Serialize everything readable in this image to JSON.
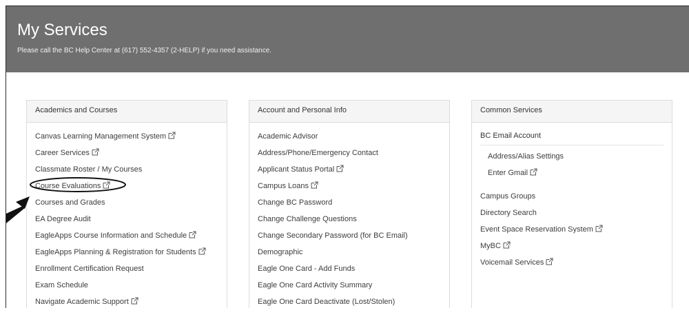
{
  "header": {
    "title": "My Services",
    "subtitle": "Please call the BC Help Center at (617) 552-4357 (2-HELP) if you need assistance."
  },
  "panels": [
    {
      "title": "Academics and Courses",
      "items": [
        {
          "label": "Canvas Learning Management System",
          "external": true
        },
        {
          "label": "Career Services",
          "external": true
        },
        {
          "label": "Classmate Roster / My Courses",
          "external": false
        },
        {
          "label": "Course Evaluations",
          "external": true
        },
        {
          "label": "Courses and Grades",
          "external": false
        },
        {
          "label": "EA Degree Audit",
          "external": false
        },
        {
          "label": "EagleApps Course Information and Schedule",
          "external": true
        },
        {
          "label": "EagleApps Planning & Registration for Students",
          "external": true
        },
        {
          "label": "Enrollment Certification Request",
          "external": false
        },
        {
          "label": "Exam Schedule",
          "external": false
        },
        {
          "label": "Navigate Academic Support",
          "external": true
        }
      ]
    },
    {
      "title": "Account and Personal Info",
      "items": [
        {
          "label": "Academic Advisor",
          "external": false
        },
        {
          "label": "Address/Phone/Emergency Contact",
          "external": false
        },
        {
          "label": "Applicant Status Portal",
          "external": true
        },
        {
          "label": "Campus Loans",
          "external": true
        },
        {
          "label": "Change BC Password",
          "external": false
        },
        {
          "label": "Change Challenge Questions",
          "external": false
        },
        {
          "label": "Change Secondary Password (for BC Email)",
          "external": false
        },
        {
          "label": "Demographic",
          "external": false
        },
        {
          "label": "Eagle One Card - Add Funds",
          "external": false
        },
        {
          "label": "Eagle One Card Activity Summary",
          "external": false
        },
        {
          "label": "Eagle One Card Deactivate (Lost/Stolen)",
          "external": false
        }
      ]
    },
    {
      "title": "Common Services",
      "email_heading": "BC Email Account",
      "email_items": [
        {
          "label": "Address/Alias Settings",
          "external": false
        },
        {
          "label": "Enter Gmail",
          "external": true
        }
      ],
      "items": [
        {
          "label": "Campus Groups",
          "external": false
        },
        {
          "label": "Directory Search",
          "external": false
        },
        {
          "label": "Event Space Reservation System",
          "external": true
        },
        {
          "label": "MyBC",
          "external": true
        },
        {
          "label": "Voicemail Services",
          "external": true
        }
      ]
    }
  ],
  "annotation": {
    "highlighted_item": "Course Evaluations",
    "pointer": "arrow"
  }
}
